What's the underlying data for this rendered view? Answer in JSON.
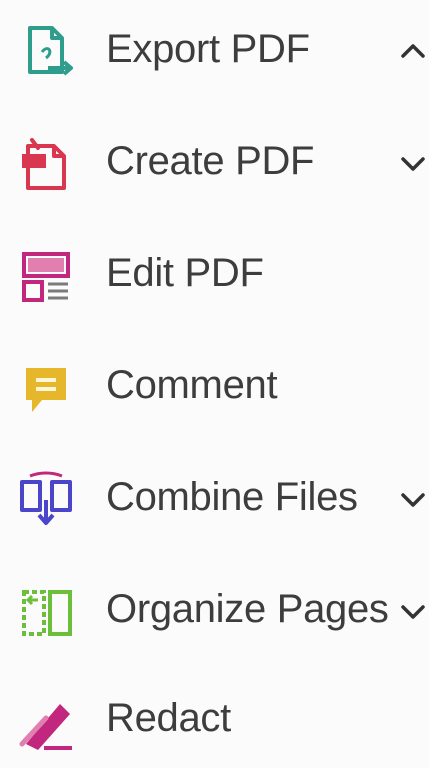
{
  "tools": {
    "items": [
      {
        "label": "Export PDF",
        "icon": "export-pdf-icon",
        "color": "#2e9d8b",
        "chevron": "up"
      },
      {
        "label": "Create PDF",
        "icon": "create-pdf-icon",
        "color": "#d9364f",
        "chevron": "down"
      },
      {
        "label": "Edit PDF",
        "icon": "edit-pdf-icon",
        "color": "#c2277e",
        "chevron": "none"
      },
      {
        "label": "Comment",
        "icon": "comment-icon",
        "color": "#e6b72a",
        "chevron": "none"
      },
      {
        "label": "Combine Files",
        "icon": "combine-files-icon",
        "color": "#4b46c9",
        "chevron": "down"
      },
      {
        "label": "Organize Pages",
        "icon": "organize-pages-icon",
        "color": "#6cbf3b",
        "chevron": "down"
      },
      {
        "label": "Redact",
        "icon": "redact-icon",
        "color": "#c2277e",
        "chevron": "none"
      }
    ]
  }
}
